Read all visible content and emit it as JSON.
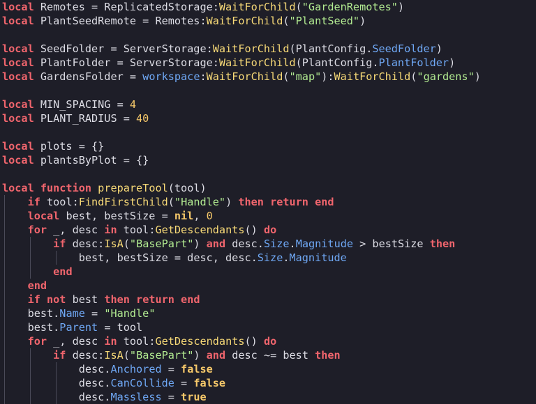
{
  "theme": {
    "background": "#1e1e28",
    "text": "#dcdce4",
    "keyword": "#f0656d",
    "string": "#b2eb91",
    "number": "#f7c96a",
    "function": "#f7d977",
    "property": "#6fa8f5",
    "indent_guide": "#4a4a58"
  },
  "code_lines": [
    {
      "indent": 0,
      "tokens": [
        [
          "kw",
          "local"
        ],
        [
          "txt",
          " Remotes = ReplicatedStorage:"
        ],
        [
          "fn",
          "WaitForChild"
        ],
        [
          "txt",
          "("
        ],
        [
          "str",
          "\"GardenRemotes\""
        ],
        [
          "txt",
          ")"
        ]
      ]
    },
    {
      "indent": 0,
      "tokens": [
        [
          "kw",
          "local"
        ],
        [
          "txt",
          " PlantSeedRemote = Remotes:"
        ],
        [
          "fn",
          "WaitForChild"
        ],
        [
          "txt",
          "("
        ],
        [
          "str",
          "\"PlantSeed\""
        ],
        [
          "txt",
          ")"
        ]
      ]
    },
    {
      "indent": 0,
      "tokens": []
    },
    {
      "indent": 0,
      "tokens": [
        [
          "kw",
          "local"
        ],
        [
          "txt",
          " SeedFolder = ServerStorage:"
        ],
        [
          "fn",
          "WaitForChild"
        ],
        [
          "txt",
          "(PlantConfig."
        ],
        [
          "prop",
          "SeedFolder"
        ],
        [
          "txt",
          ")"
        ]
      ]
    },
    {
      "indent": 0,
      "tokens": [
        [
          "kw",
          "local"
        ],
        [
          "txt",
          " PlantFolder = ServerStorage:"
        ],
        [
          "fn",
          "WaitForChild"
        ],
        [
          "txt",
          "(PlantConfig."
        ],
        [
          "prop",
          "PlantFolder"
        ],
        [
          "txt",
          ")"
        ]
      ]
    },
    {
      "indent": 0,
      "tokens": [
        [
          "kw",
          "local"
        ],
        [
          "txt",
          " GardensFolder = "
        ],
        [
          "glob",
          "workspace"
        ],
        [
          "txt",
          ":"
        ],
        [
          "fn",
          "WaitForChild"
        ],
        [
          "txt",
          "("
        ],
        [
          "str",
          "\"map\""
        ],
        [
          "txt",
          "):"
        ],
        [
          "fn",
          "WaitForChild"
        ],
        [
          "txt",
          "("
        ],
        [
          "str",
          "\"gardens\""
        ],
        [
          "txt",
          ")"
        ]
      ]
    },
    {
      "indent": 0,
      "tokens": []
    },
    {
      "indent": 0,
      "tokens": [
        [
          "kw",
          "local"
        ],
        [
          "txt",
          " MIN_SPACING = "
        ],
        [
          "num",
          "4"
        ]
      ]
    },
    {
      "indent": 0,
      "tokens": [
        [
          "kw",
          "local"
        ],
        [
          "txt",
          " PLANT_RADIUS = "
        ],
        [
          "num",
          "40"
        ]
      ]
    },
    {
      "indent": 0,
      "tokens": []
    },
    {
      "indent": 0,
      "tokens": [
        [
          "kw",
          "local"
        ],
        [
          "txt",
          " plots = {}"
        ]
      ]
    },
    {
      "indent": 0,
      "tokens": [
        [
          "kw",
          "local"
        ],
        [
          "txt",
          " plantsByPlot = {}"
        ]
      ]
    },
    {
      "indent": 0,
      "tokens": []
    },
    {
      "indent": 0,
      "tokens": [
        [
          "kw",
          "local function"
        ],
        [
          "txt",
          " "
        ],
        [
          "fn",
          "prepareTool"
        ],
        [
          "txt",
          "(tool)"
        ]
      ]
    },
    {
      "indent": 1,
      "tokens": [
        [
          "kw",
          "if"
        ],
        [
          "txt",
          " tool:"
        ],
        [
          "fn",
          "FindFirstChild"
        ],
        [
          "txt",
          "("
        ],
        [
          "str",
          "\"Handle\""
        ],
        [
          "txt",
          ") "
        ],
        [
          "kw",
          "then return end"
        ]
      ]
    },
    {
      "indent": 1,
      "tokens": [
        [
          "kw",
          "local"
        ],
        [
          "txt",
          " best, bestSize = "
        ],
        [
          "bool",
          "nil"
        ],
        [
          "txt",
          ", "
        ],
        [
          "num",
          "0"
        ]
      ]
    },
    {
      "indent": 1,
      "tokens": [
        [
          "kw",
          "for"
        ],
        [
          "txt",
          " _, desc "
        ],
        [
          "kw",
          "in"
        ],
        [
          "txt",
          " tool:"
        ],
        [
          "fn",
          "GetDescendants"
        ],
        [
          "txt",
          "() "
        ],
        [
          "kw",
          "do"
        ]
      ]
    },
    {
      "indent": 2,
      "tokens": [
        [
          "kw",
          "if"
        ],
        [
          "txt",
          " desc:"
        ],
        [
          "fn",
          "IsA"
        ],
        [
          "txt",
          "("
        ],
        [
          "str",
          "\"BasePart\""
        ],
        [
          "txt",
          ") "
        ],
        [
          "kw",
          "and"
        ],
        [
          "txt",
          " desc."
        ],
        [
          "prop",
          "Size"
        ],
        [
          "txt",
          "."
        ],
        [
          "prop",
          "Magnitude"
        ],
        [
          "txt",
          " > bestSize "
        ],
        [
          "kw",
          "then"
        ]
      ]
    },
    {
      "indent": 3,
      "tokens": [
        [
          "txt",
          "best, bestSize = desc, desc."
        ],
        [
          "prop",
          "Size"
        ],
        [
          "txt",
          "."
        ],
        [
          "prop",
          "Magnitude"
        ]
      ]
    },
    {
      "indent": 2,
      "tokens": [
        [
          "kw",
          "end"
        ]
      ]
    },
    {
      "indent": 1,
      "tokens": [
        [
          "kw",
          "end"
        ]
      ]
    },
    {
      "indent": 1,
      "tokens": [
        [
          "kw",
          "if not"
        ],
        [
          "txt",
          " best "
        ],
        [
          "kw",
          "then return end"
        ]
      ]
    },
    {
      "indent": 1,
      "tokens": [
        [
          "txt",
          "best."
        ],
        [
          "prop",
          "Name"
        ],
        [
          "txt",
          " = "
        ],
        [
          "str",
          "\"Handle\""
        ]
      ]
    },
    {
      "indent": 1,
      "tokens": [
        [
          "txt",
          "best."
        ],
        [
          "prop",
          "Parent"
        ],
        [
          "txt",
          " = tool"
        ]
      ]
    },
    {
      "indent": 1,
      "tokens": [
        [
          "kw",
          "for"
        ],
        [
          "txt",
          " _, desc "
        ],
        [
          "kw",
          "in"
        ],
        [
          "txt",
          " tool:"
        ],
        [
          "fn",
          "GetDescendants"
        ],
        [
          "txt",
          "() "
        ],
        [
          "kw",
          "do"
        ]
      ]
    },
    {
      "indent": 2,
      "tokens": [
        [
          "kw",
          "if"
        ],
        [
          "txt",
          " desc:"
        ],
        [
          "fn",
          "IsA"
        ],
        [
          "txt",
          "("
        ],
        [
          "str",
          "\"BasePart\""
        ],
        [
          "txt",
          ") "
        ],
        [
          "kw",
          "and"
        ],
        [
          "txt",
          " desc ~= best "
        ],
        [
          "kw",
          "then"
        ]
      ]
    },
    {
      "indent": 3,
      "tokens": [
        [
          "txt",
          "desc."
        ],
        [
          "prop",
          "Anchored"
        ],
        [
          "txt",
          " = "
        ],
        [
          "bool",
          "false"
        ]
      ]
    },
    {
      "indent": 3,
      "tokens": [
        [
          "txt",
          "desc."
        ],
        [
          "prop",
          "CanCollide"
        ],
        [
          "txt",
          " = "
        ],
        [
          "bool",
          "false"
        ]
      ]
    },
    {
      "indent": 3,
      "tokens": [
        [
          "txt",
          "desc."
        ],
        [
          "prop",
          "Massless"
        ],
        [
          "txt",
          " = "
        ],
        [
          "bool",
          "true"
        ]
      ]
    }
  ]
}
